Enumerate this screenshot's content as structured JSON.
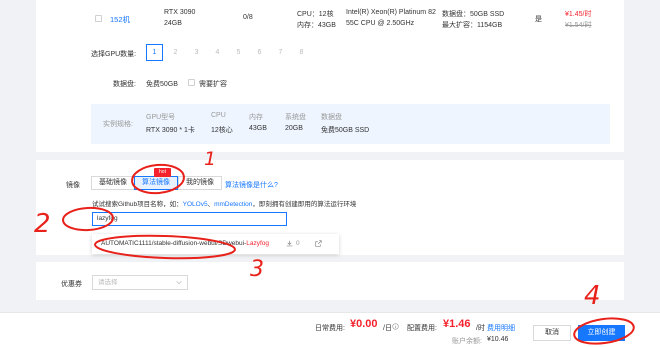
{
  "machine_row": {
    "name": "152机",
    "gpu_model": "RTX 3090",
    "gpu_memory": "24GB",
    "gpu_free": "0/8",
    "cpu": "CPU：12核",
    "memory": "内存：43GB",
    "cpu_model_line1": "Intel(R) Xeon(R) Platinum 82",
    "cpu_model_line2": "55C CPU @ 2.50GHz",
    "data_disk": "数据盘：50GB SSD",
    "max_expand": "最大扩容：1154GB",
    "expandable": "是",
    "price": "¥1.45/时",
    "original_price": "¥1.54/时"
  },
  "gpu_selector": {
    "label": "选择GPU数量:",
    "options": [
      "1",
      "2",
      "3",
      "4",
      "5",
      "6",
      "7",
      "8"
    ],
    "selected": "1"
  },
  "data_disk": {
    "label": "数据盘:",
    "value": "免费50GB",
    "expand_label": "需要扩容"
  },
  "spec": {
    "row_label": "实例规格:",
    "headers": [
      "GPU型号",
      "CPU",
      "内存",
      "系统盘",
      "数据盘"
    ],
    "values": [
      "RTX 3090 * 1卡",
      "12核心",
      "43GB",
      "20GB",
      "免费50GB SSD"
    ]
  },
  "image": {
    "label": "镜像",
    "tabs": [
      "基础镜像",
      "算法镜像",
      "我的镜像"
    ],
    "active_tab": "算法镜像",
    "hot_badge": "hot",
    "help_link": "算法镜像是什么?",
    "hint_prefix": "试试搜索Github项目名称，如：",
    "hint_link1": "YOLOv5",
    "hint_sep": "、",
    "hint_link2": "mmDetection",
    "hint_suffix": "，即刻拥有创建即用的算法运行环境",
    "search_value": "lazyfog",
    "result_prefix": "AUTOMATIC1111/stable-diffusion-webui/SDwebui-",
    "result_match": "Lazyfog",
    "result_downloads": "0"
  },
  "coupon": {
    "label": "优惠券",
    "placeholder": "请选择"
  },
  "footer": {
    "daily_label": "日常费用:",
    "daily_value": "¥0.00",
    "daily_unit": "/日",
    "config_label": "配置费用:",
    "config_value": "¥1.46",
    "config_unit": "/时",
    "fee_detail": "费用明细",
    "balance_label": "账户余额:",
    "balance_value": "¥10.46",
    "cancel": "取消",
    "create": "立即创建"
  },
  "annotations": {
    "step1": "1",
    "step2": "2",
    "step3": "3",
    "step4": "4",
    "color": "#e8211a"
  }
}
